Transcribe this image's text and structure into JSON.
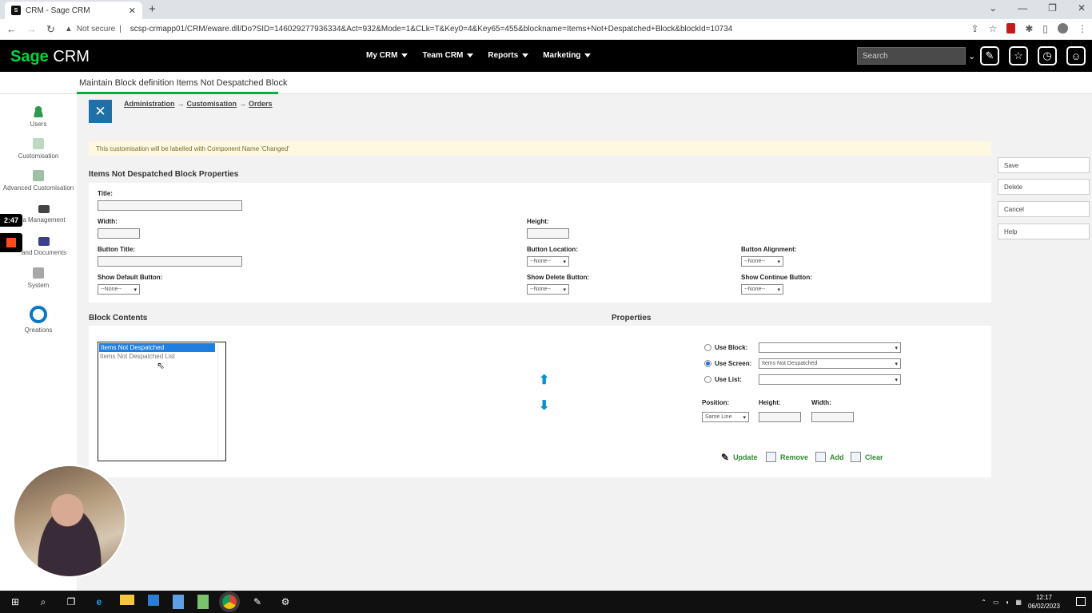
{
  "browser": {
    "tab_title": "CRM - Sage CRM",
    "security_label": "Not secure",
    "url": "scsp-crmapp01/CRM/eware.dll/Do?SID=146029277936334&Act=932&Mode=1&CLk=T&Key0=4&Key65=455&blockname=Items+Not+Despatched+Block&blockId=10734"
  },
  "header": {
    "logo_sage": "Sage",
    "logo_crm": " CRM",
    "menu": [
      {
        "label": "My CRM"
      },
      {
        "label": "Team CRM"
      },
      {
        "label": "Reports"
      },
      {
        "label": "Marketing"
      }
    ],
    "search_placeholder": "Search"
  },
  "page_title": "Maintain Block definition Items Not Despatched Block",
  "sidebar": {
    "items": [
      {
        "label": "Users"
      },
      {
        "label": "Customisation"
      },
      {
        "label": "Advanced Customisation"
      },
      {
        "label": "a Management"
      },
      {
        "label": "and Documents"
      },
      {
        "label": "System"
      },
      {
        "label": "Qreations"
      }
    ],
    "timer": "2:47"
  },
  "breadcrumb": {
    "items": [
      "Administration",
      "Customisation",
      "Orders"
    ],
    "sep": "→"
  },
  "notice": "This customisation will be labelled with Component Name 'Changed'",
  "block_properties": {
    "title": "Items Not Despatched Block Properties",
    "fields": {
      "title_label": "Title:",
      "width_label": "Width:",
      "height_label": "Height:",
      "button_title_label": "Button Title:",
      "button_location_label": "Button Location:",
      "button_alignment_label": "Button Alignment:",
      "show_default_label": "Show Default Button:",
      "show_delete_label": "Show Delete Button:",
      "show_continue_label": "Show Continue Button:",
      "none_option": "--None--"
    }
  },
  "actions": {
    "save": "Save",
    "delete": "Delete",
    "cancel": "Cancel",
    "help": "Help"
  },
  "block_contents": {
    "title": "Block Contents",
    "items": [
      "Items Not Despatched",
      "Items Not Despatched List"
    ],
    "selected_index": 0
  },
  "properties": {
    "title": "Properties",
    "use_block_label": "Use Block:",
    "use_screen_label": "Use Screen:",
    "use_list_label": "Use List:",
    "use_screen_value": "Items Not Despatched",
    "position_label": "Position:",
    "height_label": "Height:",
    "width_label": "Width:",
    "position_value": "Same Line",
    "buttons": {
      "update": "Update",
      "remove": "Remove",
      "add": "Add",
      "clear": "Clear"
    }
  },
  "taskbar": {
    "time": "12:17",
    "date": "06/02/2023"
  }
}
